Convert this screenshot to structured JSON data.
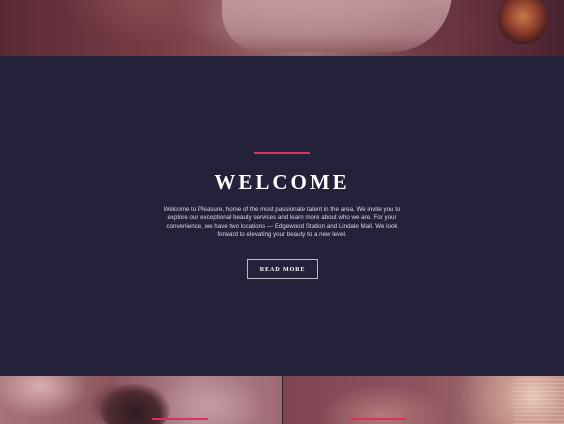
{
  "welcome": {
    "title": "WELCOME",
    "body": "Welcome to Pleasure, home of the most passionate talent in the area. We invite you to explore our exceptional beauty services and learn more about who we are. For your convenience, we have two locations — Edgewood Station and Lindale Mall. We look forward to elevating your beauty to a new level.",
    "button_label": "READ MORE"
  },
  "colors": {
    "background": "#24223a",
    "accent": "#d8325e",
    "text": "#ffffff"
  }
}
